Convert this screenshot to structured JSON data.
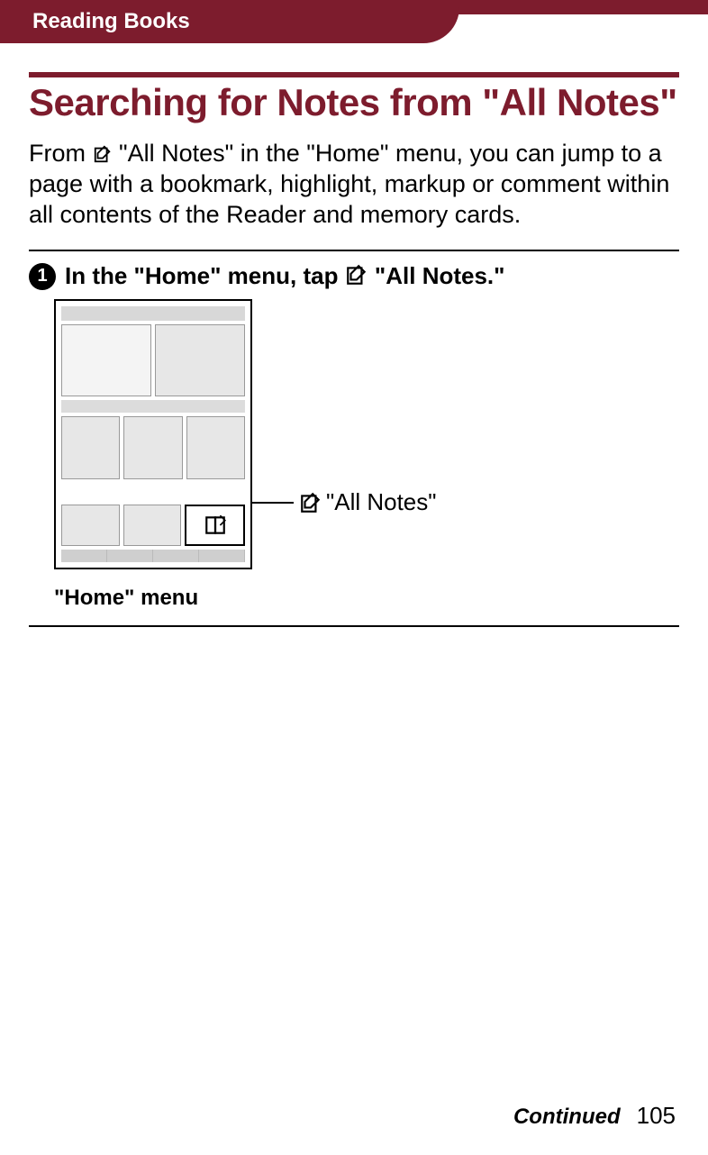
{
  "header": {
    "section": "Reading Books"
  },
  "title": "Searching for Notes from \"All Notes\"",
  "intro": {
    "pre": "From ",
    "post": " \"All Notes\" in the \"Home\" menu, you can jump to a page with a bookmark, highlight, markup or comment within all contents of the Reader and memory cards."
  },
  "step": {
    "number": "1",
    "pre": "In the \"Home\" menu, tap ",
    "post": " \"All Notes.\""
  },
  "figure": {
    "pointer_label": " \"All Notes\"",
    "caption": "\"Home\" menu"
  },
  "footer": {
    "continued": "Continued",
    "page": "105"
  }
}
